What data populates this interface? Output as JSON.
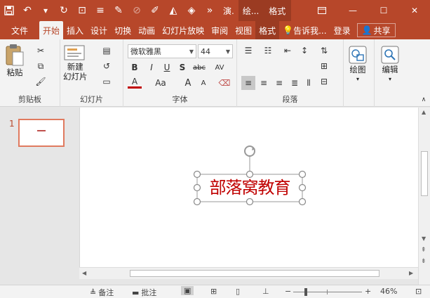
{
  "titlebar": {
    "doc_tabs": [
      "演.",
      "绘..."
    ],
    "more": "»"
  },
  "tabs": [
    "文件",
    "开始",
    "插入",
    "设计",
    "切换",
    "动画",
    "幻灯片放映",
    "审阅",
    "视图",
    "格式"
  ],
  "tell_me": "告诉我...",
  "login": "登录",
  "share": "共享",
  "ribbon": {
    "clipboard": {
      "paste": "粘贴",
      "label": "剪贴板"
    },
    "slides": {
      "new_slide_1": "新建",
      "new_slide_2": "幻灯片",
      "label": "幻灯片"
    },
    "font": {
      "font_name": "微软雅黑",
      "font_size": "44",
      "label": "字体",
      "bold": "B",
      "italic": "I",
      "underline": "U",
      "shadow": "S",
      "strike": "abc",
      "spacing": "AV",
      "font_color": "A",
      "change_case": "Aa",
      "grow": "A",
      "shrink": "A"
    },
    "paragraph": {
      "label": "段落"
    },
    "drawing": {
      "label": "绘图"
    },
    "editing": {
      "label": "编辑"
    }
  },
  "slide": {
    "number": "1",
    "textbox_text": "部落窝教育"
  },
  "status": {
    "notes": "备注",
    "comments": "批注",
    "zoom": "46%",
    "minus": "−",
    "plus": "+"
  },
  "colors": {
    "accent": "#b7472a",
    "text_red": "#c00000"
  }
}
